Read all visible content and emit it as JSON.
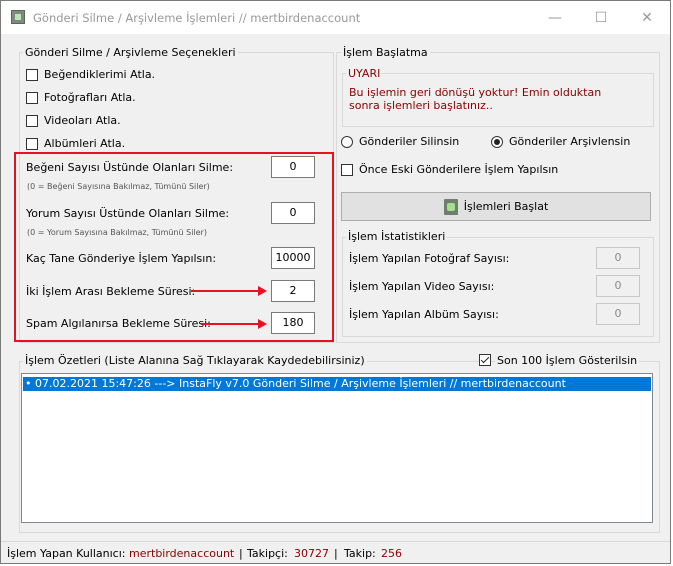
{
  "window": {
    "title": "Gönderi Silme / Arşivleme İşlemleri // mertbirdenaccount",
    "minimize": "—",
    "maximize": "☐",
    "close": "✕"
  },
  "options": {
    "group_title": "Gönderi Silme / Arşivleme Seçenekleri",
    "skip_liked": "Beğendiklerimi Atla.",
    "skip_photos": "Fotoğrafları Atla.",
    "skip_videos": "Videoları Atla.",
    "skip_albums": "Albümleri Atla.",
    "likes_label": "Beğeni Sayısı Üstünde Olanları Silme:",
    "likes_value": "0",
    "likes_hint": "(0 = Beğeni Sayısına Bakılmaz, Tümünü Siler)",
    "comments_label": "Yorum Sayısı Üstünde Olanları Silme:",
    "comments_value": "0",
    "comments_hint": "(0 = Yorum Sayısına Bakılmaz, Tümünü Siler)",
    "post_count_label": "Kaç Tane Gönderiye İşlem Yapılsın:",
    "post_count_value": "10000",
    "wait_label": "İki İşlem Arası Bekleme Süresi:",
    "wait_value": "2",
    "spam_wait_label": "Spam Algılanırsa Bekleme Süresi:",
    "spam_wait_value": "180"
  },
  "start": {
    "group_title": "İşlem Başlatma",
    "warning_title": "UYARI",
    "warning_line1": "Bu işlemin geri dönüşü yoktur! Emin olduktan",
    "warning_line2": "sonra işlemleri başlatınız..",
    "radio_delete": "Gönderiler Silinsin",
    "radio_archive": "Gönderiler Arşivlensin",
    "old_first": "Önce Eski Gönderilere İşlem Yapılsın",
    "start_button": "İşlemleri Başlat"
  },
  "stats": {
    "group_title": "İşlem İstatistikleri",
    "photo_label": "İşlem Yapılan Fotoğraf Sayısı:",
    "photo_value": "0",
    "video_label": "İşlem Yapılan Video Sayısı:",
    "video_value": "0",
    "album_label": "İşlem Yapılan Albüm Sayısı:",
    "album_value": "0"
  },
  "summary": {
    "group_title": "İşlem Özetleri (Liste Alanına Sağ Tıklayarak Kaydedebilirsiniz)",
    "last100": "Son 100 İşlem Gösterilsin",
    "rows": [
      "07.02.2021 15:47:26 ---> InstaFly v7.0 Gönderi Silme / Arşivleme İşlemleri // mertbirdenaccount"
    ]
  },
  "status": {
    "user_label": "İşlem Yapan Kullanıcı:",
    "user": "mertbirdenaccount",
    "sep1": "|",
    "followers_label": "Takipçi:",
    "followers": "30727",
    "sep2": "|",
    "following_label": "Takip:",
    "following": "256"
  },
  "colors": {
    "highlight_red": "#e81123",
    "dark_red": "#8b0000",
    "selection_blue": "#0078d7"
  }
}
